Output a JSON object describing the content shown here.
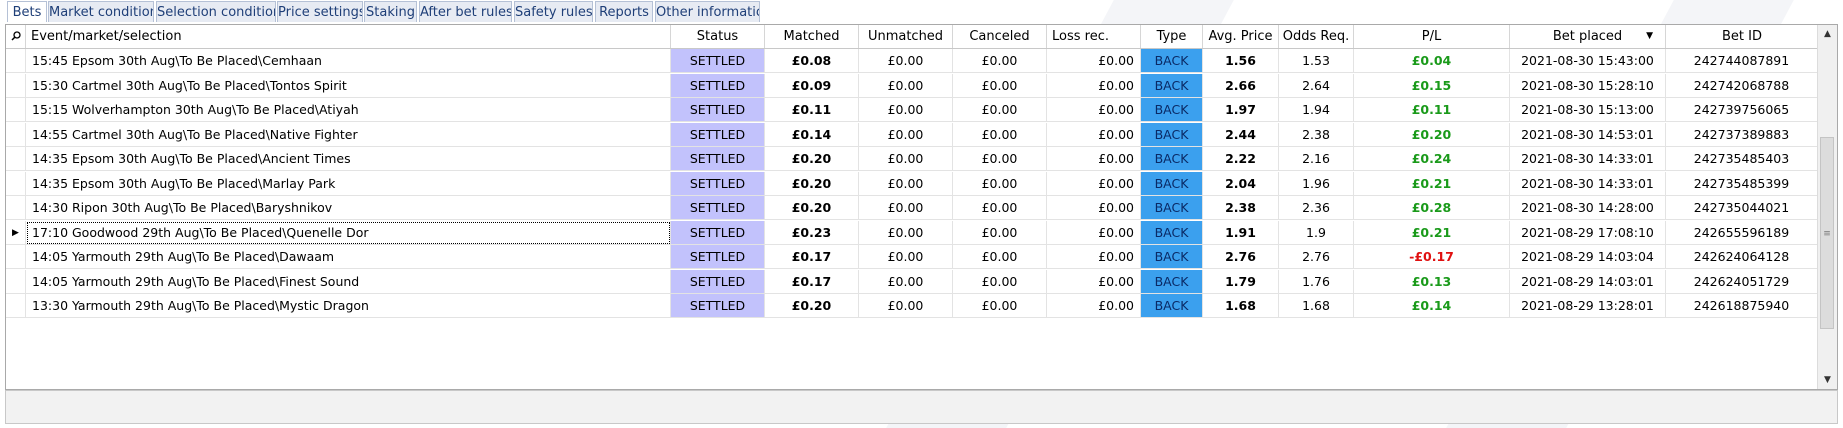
{
  "tabs": [
    {
      "label": "Bets"
    },
    {
      "label": "Market conditions"
    },
    {
      "label": "Selection conditions"
    },
    {
      "label": "Price settings"
    },
    {
      "label": "Staking"
    },
    {
      "label": "After bet rules"
    },
    {
      "label": "Safety rules"
    },
    {
      "label": "Reports"
    },
    {
      "label": "Other information"
    }
  ],
  "grid": {
    "search_icon": "magnifier-icon",
    "sort_indicator": "sort-descending-icon",
    "columns": {
      "event": "Event/market/selection",
      "status": "Status",
      "matched": "Matched",
      "unmatched": "Unmatched",
      "canceled": "Canceled",
      "loss_rec": "Loss rec.",
      "type": "Type",
      "avg_price": "Avg. Price",
      "odds_req": "Odds Req.",
      "pl": "P/L",
      "bet_placed": "Bet placed",
      "bet_id": "Bet ID"
    },
    "rows": [
      {
        "event": "15:45 Epsom 30th Aug\\To Be Placed\\Cemhaan",
        "status": "SETTLED",
        "matched": "£0.08",
        "unmatched": "£0.00",
        "canceled": "£0.00",
        "loss_rec": "£0.00",
        "type": "BACK",
        "avg_price": "1.56",
        "odds_req": "1.53",
        "pl": "£0.04",
        "bet_placed": "2021-08-30 15:43:00",
        "bet_id": "242744087891"
      },
      {
        "event": "15:30 Cartmel 30th Aug\\To Be Placed\\Tontos Spirit",
        "status": "SETTLED",
        "matched": "£0.09",
        "unmatched": "£0.00",
        "canceled": "£0.00",
        "loss_rec": "£0.00",
        "type": "BACK",
        "avg_price": "2.66",
        "odds_req": "2.64",
        "pl": "£0.15",
        "bet_placed": "2021-08-30 15:28:10",
        "bet_id": "242742068788"
      },
      {
        "event": "15:15 Wolverhampton 30th Aug\\To Be Placed\\Atiyah",
        "status": "SETTLED",
        "matched": "£0.11",
        "unmatched": "£0.00",
        "canceled": "£0.00",
        "loss_rec": "£0.00",
        "type": "BACK",
        "avg_price": "1.97",
        "odds_req": "1.94",
        "pl": "£0.11",
        "bet_placed": "2021-08-30 15:13:00",
        "bet_id": "242739756065"
      },
      {
        "event": "14:55 Cartmel 30th Aug\\To Be Placed\\Native Fighter",
        "status": "SETTLED",
        "matched": "£0.14",
        "unmatched": "£0.00",
        "canceled": "£0.00",
        "loss_rec": "£0.00",
        "type": "BACK",
        "avg_price": "2.44",
        "odds_req": "2.38",
        "pl": "£0.20",
        "bet_placed": "2021-08-30 14:53:01",
        "bet_id": "242737389883"
      },
      {
        "event": "14:35 Epsom 30th Aug\\To Be Placed\\Ancient Times",
        "status": "SETTLED",
        "matched": "£0.20",
        "unmatched": "£0.00",
        "canceled": "£0.00",
        "loss_rec": "£0.00",
        "type": "BACK",
        "avg_price": "2.22",
        "odds_req": "2.16",
        "pl": "£0.24",
        "bet_placed": "2021-08-30 14:33:01",
        "bet_id": "242735485403"
      },
      {
        "event": "14:35 Epsom 30th Aug\\To Be Placed\\Marlay Park",
        "status": "SETTLED",
        "matched": "£0.20",
        "unmatched": "£0.00",
        "canceled": "£0.00",
        "loss_rec": "£0.00",
        "type": "BACK",
        "avg_price": "2.04",
        "odds_req": "1.96",
        "pl": "£0.21",
        "bet_placed": "2021-08-30 14:33:01",
        "bet_id": "242735485399"
      },
      {
        "event": "14:30 Ripon 30th Aug\\To Be Placed\\Baryshnikov",
        "status": "SETTLED",
        "matched": "£0.20",
        "unmatched": "£0.00",
        "canceled": "£0.00",
        "loss_rec": "£0.00",
        "type": "BACK",
        "avg_price": "2.38",
        "odds_req": "2.36",
        "pl": "£0.28",
        "bet_placed": "2021-08-30 14:28:00",
        "bet_id": "242735044021"
      },
      {
        "event": "17:10 Goodwood 29th Aug\\To Be Placed\\Quenelle Dor",
        "status": "SETTLED",
        "matched": "£0.23",
        "unmatched": "£0.00",
        "canceled": "£0.00",
        "loss_rec": "£0.00",
        "type": "BACK",
        "avg_price": "1.91",
        "odds_req": "1.9",
        "pl": "£0.21",
        "bet_placed": "2021-08-29 17:08:10",
        "bet_id": "242655596189",
        "current": true
      },
      {
        "event": "14:05 Yarmouth 29th Aug\\To Be Placed\\Dawaam",
        "status": "SETTLED",
        "matched": "£0.17",
        "unmatched": "£0.00",
        "canceled": "£0.00",
        "loss_rec": "£0.00",
        "type": "BACK",
        "avg_price": "2.76",
        "odds_req": "2.76",
        "pl": "-£0.17",
        "bet_placed": "2021-08-29 14:03:04",
        "bet_id": "242624064128"
      },
      {
        "event": "14:05 Yarmouth 29th Aug\\To Be Placed\\Finest Sound",
        "status": "SETTLED",
        "matched": "£0.17",
        "unmatched": "£0.00",
        "canceled": "£0.00",
        "loss_rec": "£0.00",
        "type": "BACK",
        "avg_price": "1.79",
        "odds_req": "1.76",
        "pl": "£0.13",
        "bet_placed": "2021-08-29 14:03:01",
        "bet_id": "242624051729"
      },
      {
        "event": "13:30 Yarmouth 29th Aug\\To Be Placed\\Mystic Dragon",
        "status": "SETTLED",
        "matched": "£0.20",
        "unmatched": "£0.00",
        "canceled": "£0.00",
        "loss_rec": "£0.00",
        "type": "BACK",
        "avg_price": "1.68",
        "odds_req": "1.68",
        "pl": "£0.14",
        "bet_placed": "2021-08-29 13:28:01",
        "bet_id": "242618875940"
      }
    ]
  },
  "colors": {
    "status_bg": "#c2c2fc",
    "type_bg": "#3ba0ee",
    "profit": "#1a9a1a",
    "loss": "#e01010",
    "tab_bg": "#e7ebf3",
    "tab_text": "#1f3f78"
  }
}
